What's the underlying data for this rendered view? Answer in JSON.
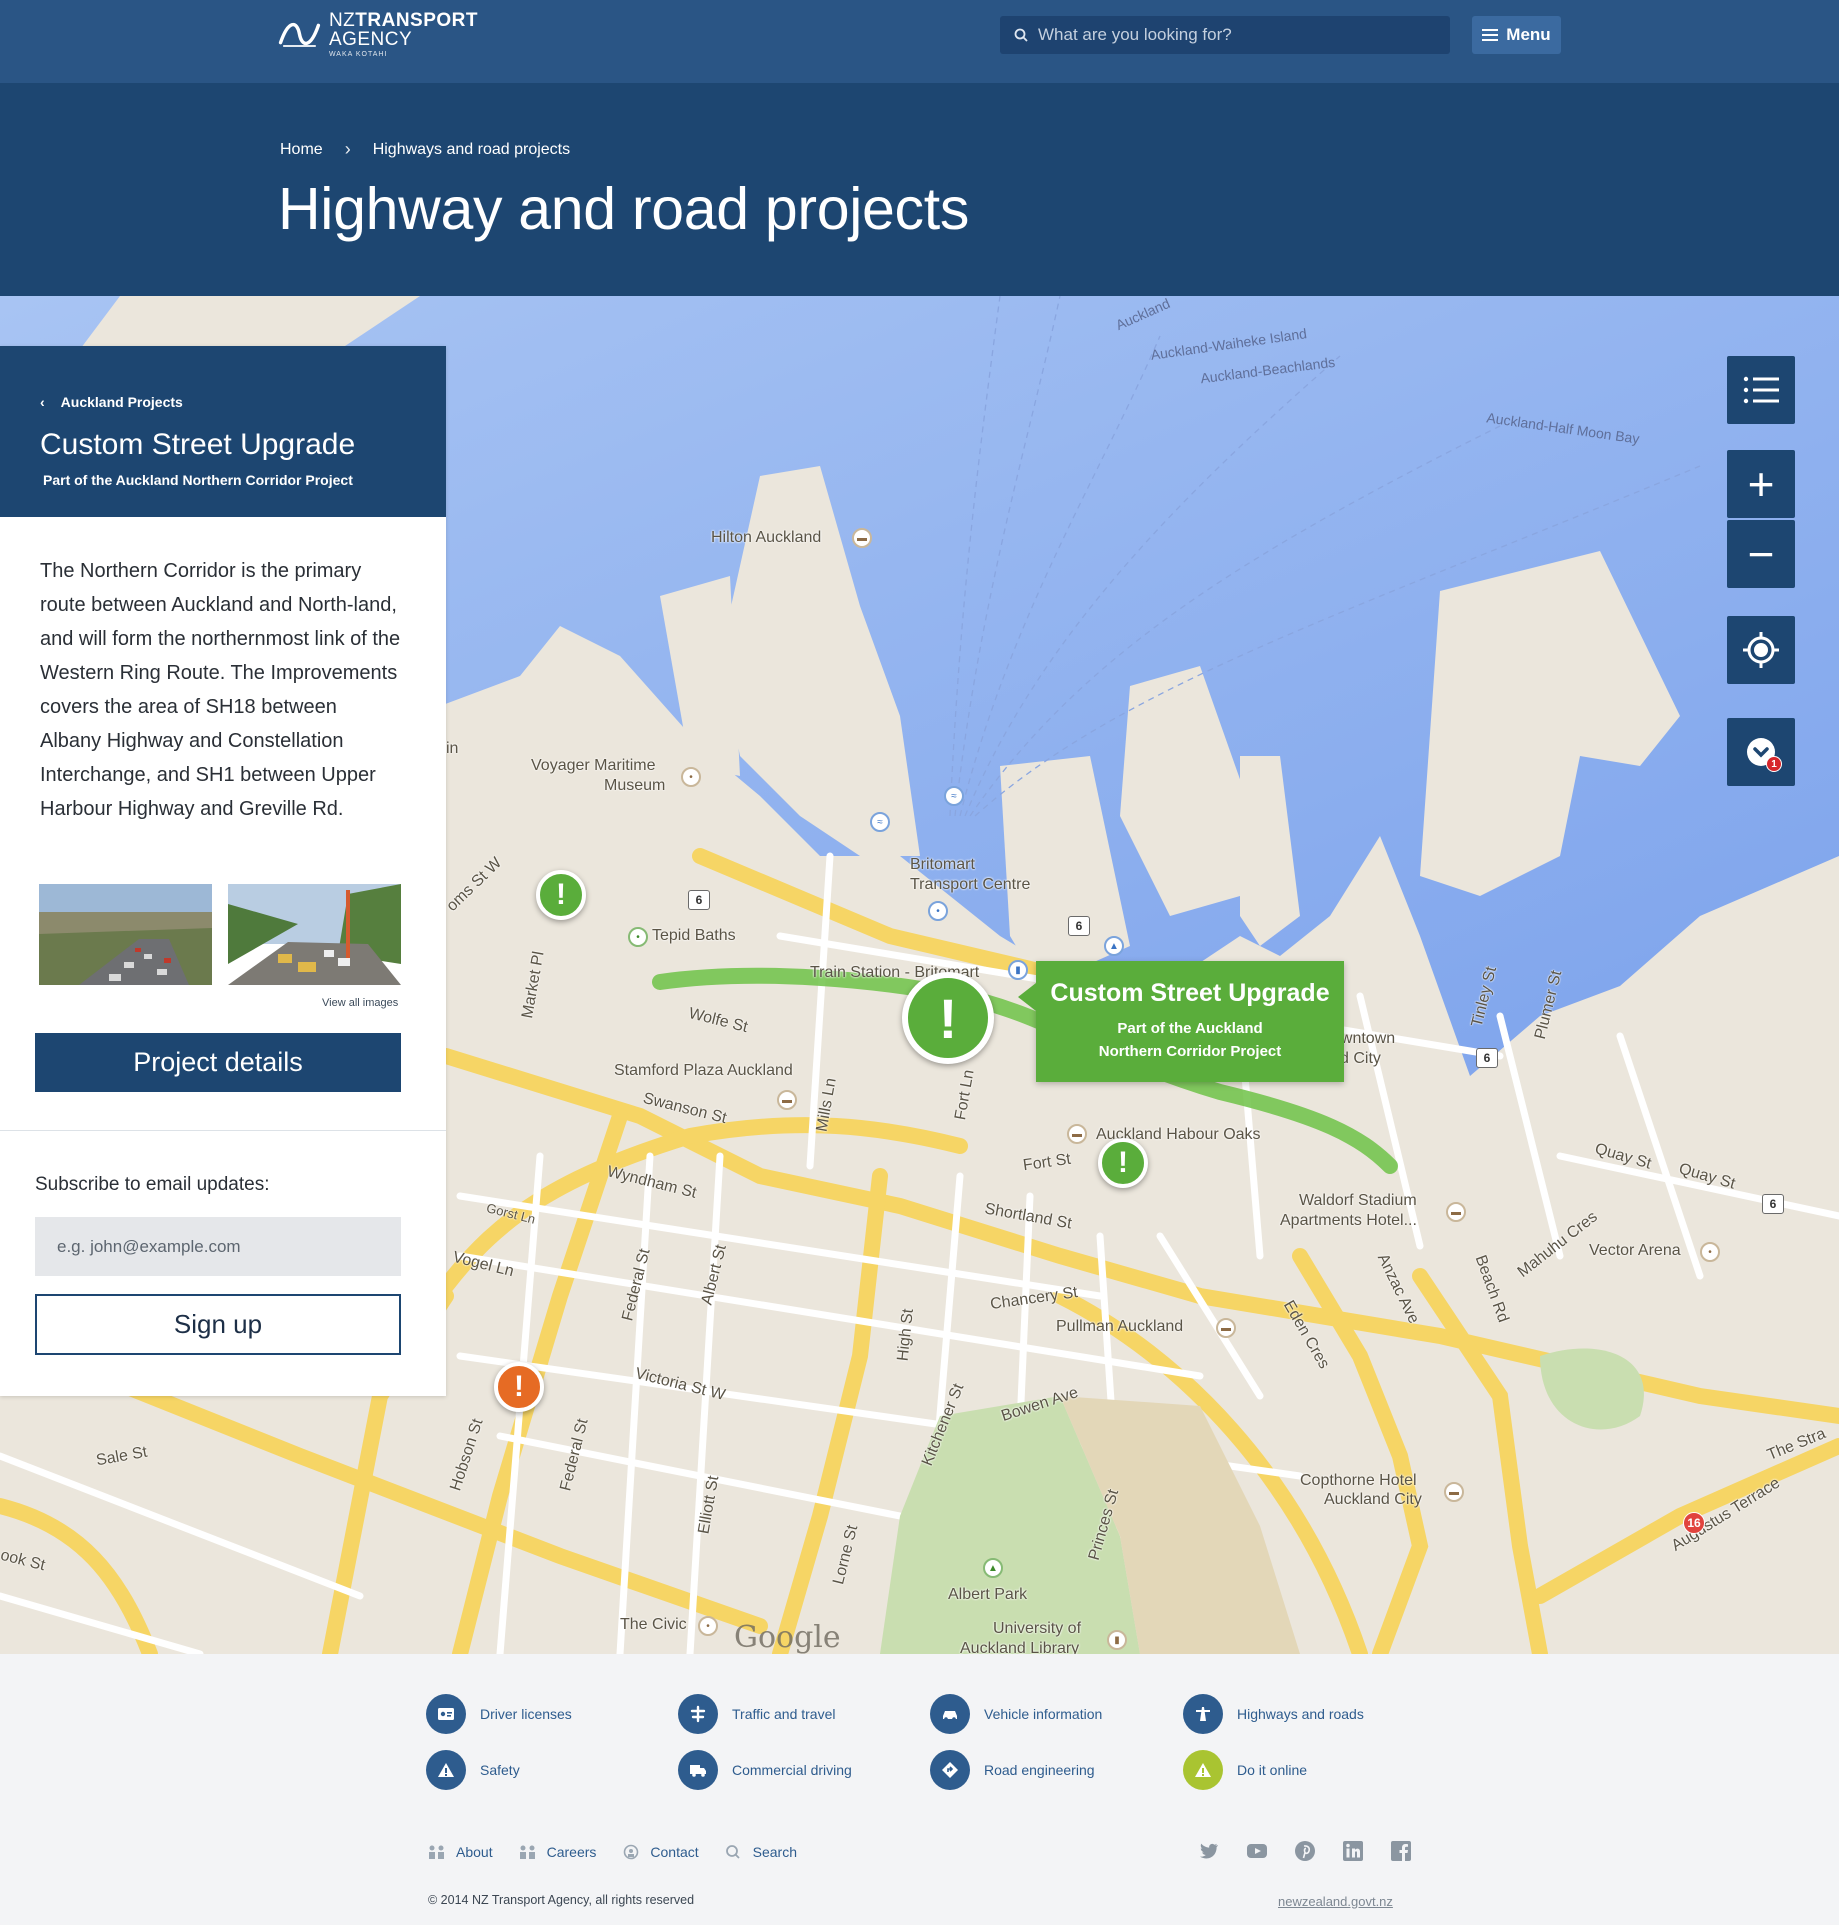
{
  "header": {
    "logo": {
      "nz": "NZ",
      "transport": "TRANSPORT",
      "agency": "AGENCY",
      "sub": "WAKA KOTAHI"
    },
    "search": {
      "placeholder": "What are you looking for?"
    },
    "menu_label": "Menu"
  },
  "breadcrumb": {
    "home": "Home",
    "sep": "›",
    "current": "Highways and road projects"
  },
  "page_title": "Highway and road projects",
  "panel": {
    "back_label": "Auckland Projects",
    "title": "Custom Street Upgrade",
    "subtitle": "Part of the Auckland Northern Corridor Project",
    "description": "The Northern Corridor is the primary route between Auckland and North-land, and will form the northernmost link of the Western Ring Route. The Improvements covers the area of SH18 between Albany Highway and Constellation Interchange, and SH1 between Upper Harbour Highway and Greville Rd.",
    "view_all": "View all images",
    "details_button": "Project details",
    "subscribe_label": "Subscribe to email updates:",
    "email_placeholder": "e.g. john@example.com",
    "signup_button": "Sign up"
  },
  "map": {
    "callout": {
      "title": "Custom Street Upgrade",
      "sub1": "Part of the Auckland",
      "sub2": "Northern Corridor Project"
    },
    "marker_glyph": "!",
    "zoom_in": "+",
    "zoom_out": "−",
    "layers_badge": "1",
    "attribution": "Google",
    "labels": {
      "hilton": "Hilton Auckland",
      "voyager1": "Voyager Maritime",
      "voyager2": "Museum",
      "britomart1": "Britomart",
      "britomart2": "Transport Centre",
      "tepid": "Tepid Baths",
      "train": "Train Station - Britomart",
      "wolfe": "Wolfe St",
      "stamford": "Stamford Plaza Auckland",
      "swanson": "Swanson St",
      "wyndham": "Wyndham St",
      "habour": "Auckland Habour Oaks",
      "fortst": "Fort St",
      "shortland": "Shortland St",
      "chancery": "Chancery St",
      "pullman": "Pullman Auckland",
      "victoria": "Victoria St W",
      "bowen": "Bowen Ave",
      "waldorf1": "Waldorf Stadium",
      "waldorf2": "Apartments Hotel...",
      "vector": "Vector Arena",
      "copthorne1": "Copthorne Hotel",
      "copthorne2": "Auckland City",
      "albert": "Albert Park",
      "university1": "University of",
      "university2": "Auckland Library",
      "civic": "The Civic",
      "sale": "Sale St",
      "hobson": "Hobson St",
      "federal": "Federal St",
      "albertst": "Albert St",
      "highst": "High St",
      "quay": "Quay St",
      "quay2": "Quay St",
      "beach": "Beach Rd",
      "anzac": "Anzac Ave",
      "eden": "Eden Cres",
      "mahuhu": "Mahuhu Cres",
      "tinley": "Tinley St",
      "plumer": "Plumer St",
      "market": "Market Pl",
      "vogel": "Vogel Ln",
      "gorst": "Gorst Ln",
      "elliott": "Elliott St",
      "lorne": "Lorne St",
      "kitchener": "Kitchener St",
      "princes": "Princes St",
      "mills": "Mills Ln",
      "fortln": "Fort Ln",
      "ferry1": "Auckland-Waiheke Island",
      "ferry2": "Auckland-Beachlands",
      "ferry3": "Auckland-Half Moon Bay",
      "ferry4": "Auckland",
      "downtown1": "owntown",
      "downtown2": "d City",
      "augustus": "Augustus Terrace",
      "thestrand": "The Stra",
      "ookst": "ook St",
      "customs": "oms St W",
      "in": "in",
      "shield6": "6",
      "shield16": "16"
    }
  },
  "footer": {
    "quick_links": [
      {
        "label": "Driver licenses",
        "icon": "id-card-icon"
      },
      {
        "label": "Traffic and travel",
        "icon": "traffic-icon"
      },
      {
        "label": "Vehicle information",
        "icon": "car-icon"
      },
      {
        "label": "Highways and roads",
        "icon": "highway-icon"
      },
      {
        "label": "Safety",
        "icon": "warning-icon"
      },
      {
        "label": "Commercial driving",
        "icon": "truck-icon"
      },
      {
        "label": "Road engineering",
        "icon": "road-sign-icon"
      },
      {
        "label": "Do it online",
        "icon": "online-icon"
      }
    ],
    "links": {
      "about": "About",
      "careers": "Careers",
      "contact": "Contact",
      "search": "Search"
    },
    "copyright": "© 2014 NZ Transport Agency, all rights reserved",
    "govt": "newzealand.govt.nz"
  },
  "colors": {
    "navy": "#1d4671",
    "header": "#2a5585",
    "project_green": "#5aad3b",
    "alert_orange": "#e66b24"
  }
}
